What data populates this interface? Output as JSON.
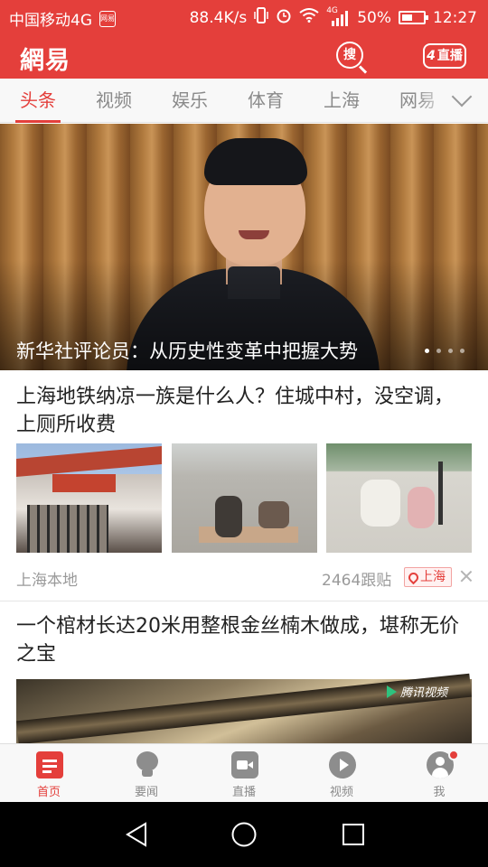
{
  "status_bar": {
    "carrier": "中国移动4G",
    "speed": "88.4K/s",
    "network": "4G",
    "battery_percent": "50%",
    "battery_level": 0.5,
    "time": "12:27"
  },
  "header": {
    "logo": "網易",
    "search_label": "搜",
    "live_count": "4",
    "live_label": "直播",
    "brand_color": "#e43f3b"
  },
  "tabs": [
    {
      "label": "头条",
      "active": true
    },
    {
      "label": "视频"
    },
    {
      "label": "娱乐"
    },
    {
      "label": "体育"
    },
    {
      "label": "上海"
    },
    {
      "label": "网易"
    }
  ],
  "hero": {
    "title": "新华社评论员：从历史性变革中把握大势",
    "slides": 4,
    "active_slide": 1
  },
  "articles": [
    {
      "title": "上海地铁纳凉一族是什么人？住城中村，没空调，上厕所收费",
      "source": "上海本地",
      "comments": "2464跟贴",
      "location": "上海"
    },
    {
      "title": "一个棺材长达20米用整根金丝楠木做成，堪称无价之宝",
      "video_watermark": "腾讯视频"
    }
  ],
  "bottom_nav": [
    {
      "label": "首页",
      "icon": "home-list-icon",
      "active": true
    },
    {
      "label": "要闻",
      "icon": "lightbulb-icon"
    },
    {
      "label": "直播",
      "icon": "video-camera-icon"
    },
    {
      "label": "视频",
      "icon": "play-circle-icon"
    },
    {
      "label": "我",
      "icon": "user-icon",
      "badge": true
    }
  ],
  "system_nav": [
    "back-icon",
    "home-icon",
    "recents-icon"
  ]
}
